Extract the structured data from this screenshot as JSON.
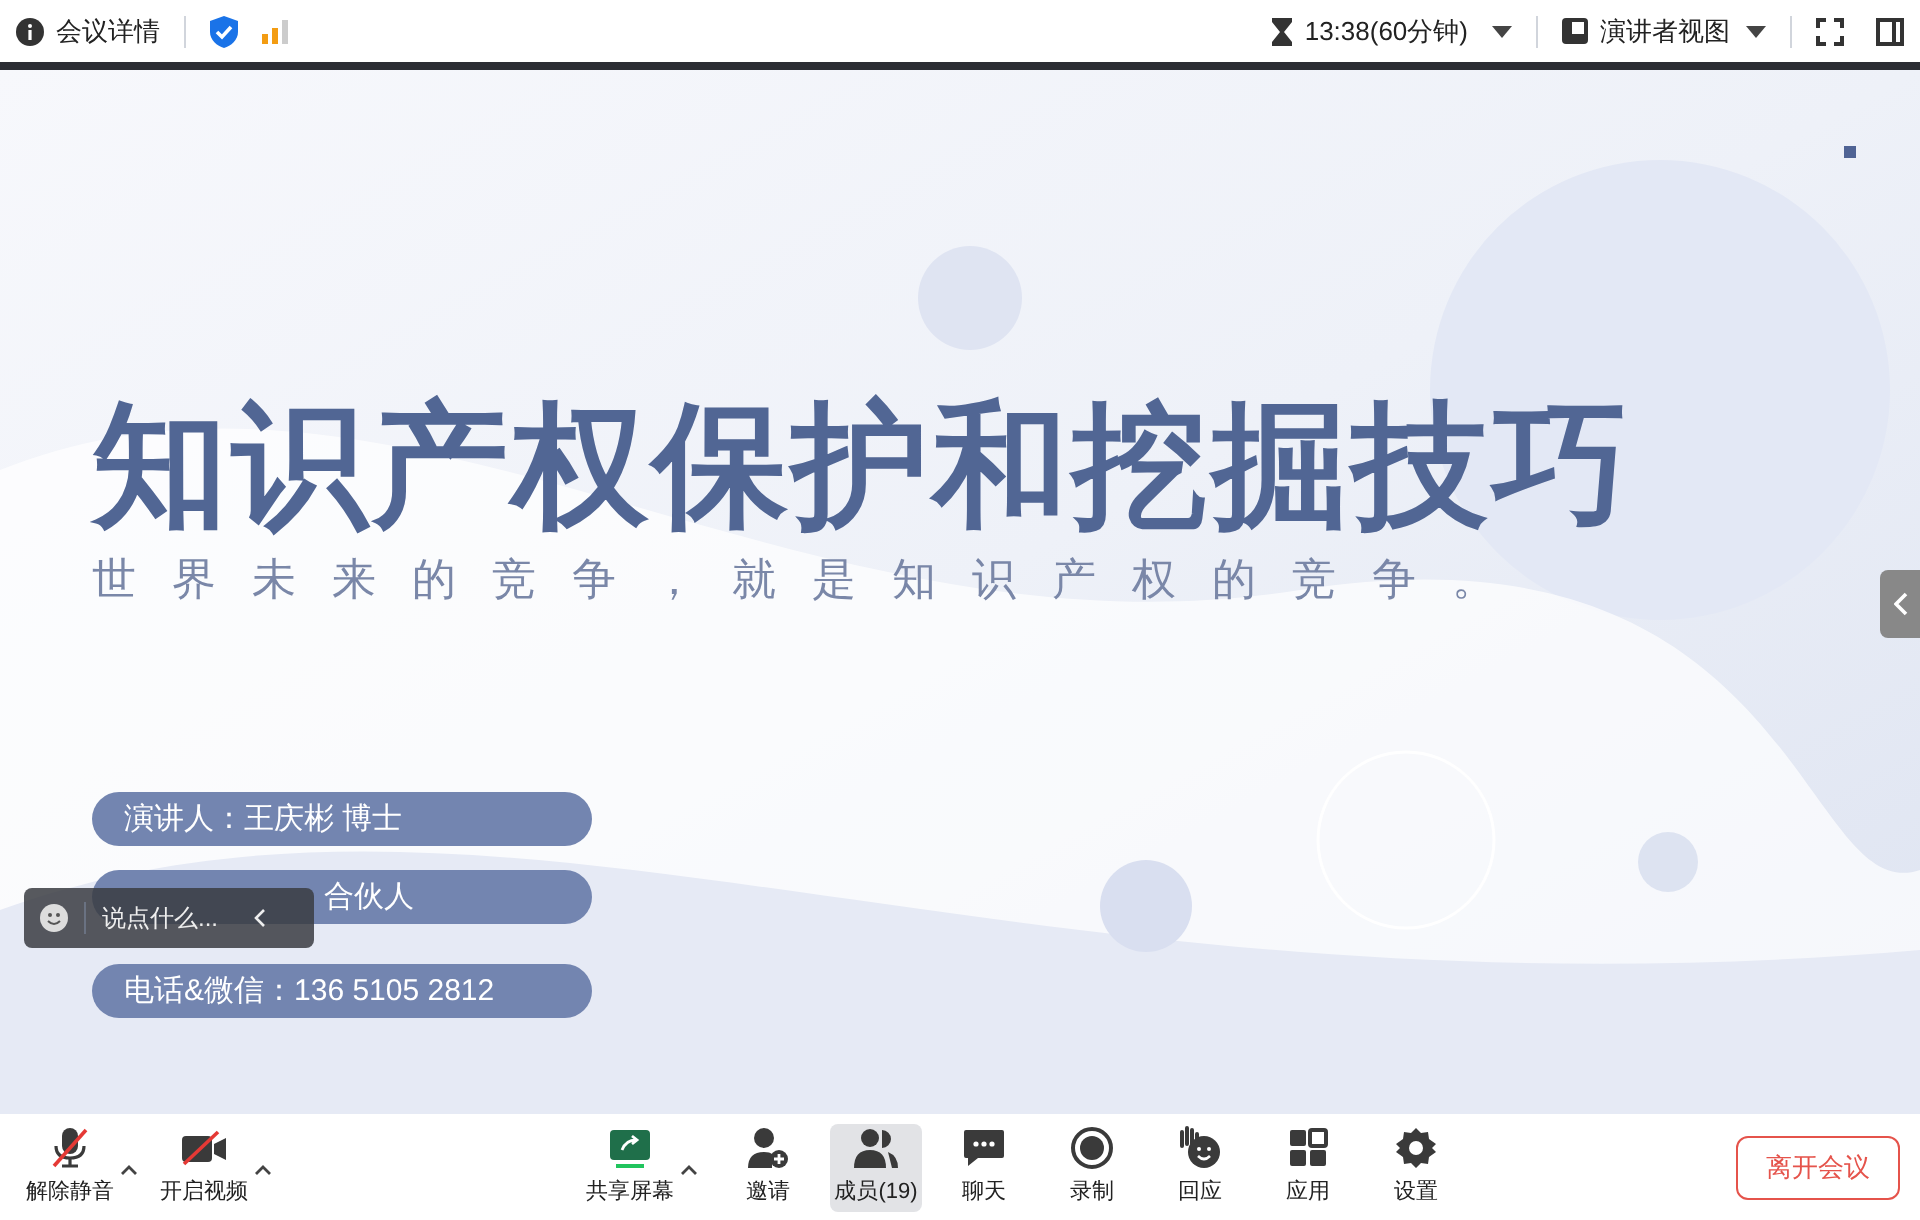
{
  "top_bar": {
    "meeting_info": "会议详情",
    "timer": "13:38(60分钟)",
    "view_mode": "演讲者视图"
  },
  "slide": {
    "title": "知识产权保护和挖掘技巧",
    "subtitle": "世界未来的竞争，就是知识产权的竞争。",
    "pills": [
      "演讲人：王庆彬 博士",
      "合伙人",
      "电话&微信：136 5105 2812"
    ]
  },
  "chat_box": {
    "placeholder": "说点什么..."
  },
  "toolbar": [
    {
      "kind": "mic",
      "label": "解除静音",
      "caret": true,
      "selected": false
    },
    {
      "kind": "video",
      "label": "开启视频",
      "caret": true,
      "selected": false
    },
    {
      "kind": "share",
      "label": "共享屏幕",
      "caret": true,
      "selected": false
    },
    {
      "kind": "invite",
      "label": "邀请",
      "caret": false,
      "selected": false
    },
    {
      "kind": "members",
      "label": "成员(19)",
      "caret": false,
      "selected": true
    },
    {
      "kind": "chat",
      "label": "聊天",
      "caret": false,
      "selected": false
    },
    {
      "kind": "record",
      "label": "录制",
      "caret": false,
      "selected": false
    },
    {
      "kind": "react",
      "label": "回应",
      "caret": false,
      "selected": false
    },
    {
      "kind": "apps",
      "label": "应用",
      "caret": false,
      "selected": false
    },
    {
      "kind": "settings",
      "label": "设置",
      "caret": false,
      "selected": false
    }
  ],
  "leave_button": "离开会议"
}
